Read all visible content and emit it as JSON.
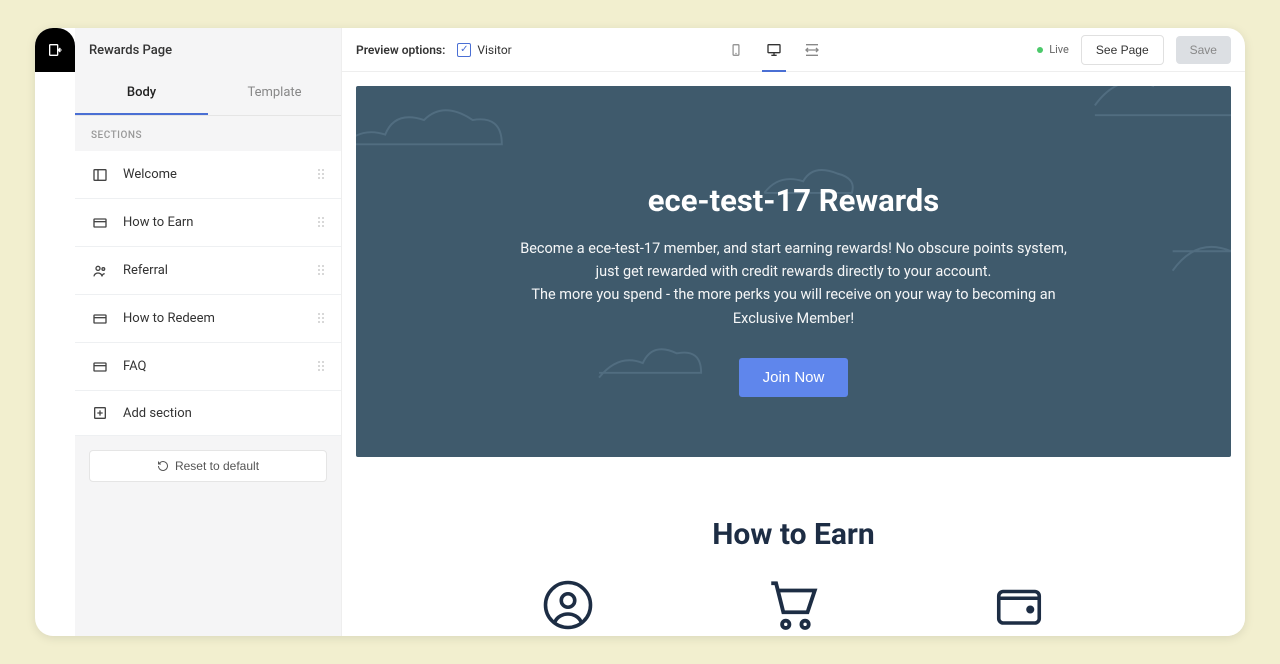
{
  "header": {
    "title": "Rewards Page"
  },
  "sidebar": {
    "tabs": [
      {
        "label": "Body",
        "active": true
      },
      {
        "label": "Template",
        "active": false
      }
    ],
    "sections_header": "SECTIONS",
    "items": [
      {
        "label": "Welcome",
        "icon": "layout-icon"
      },
      {
        "label": "How to Earn",
        "icon": "card-icon"
      },
      {
        "label": "Referral",
        "icon": "people-icon"
      },
      {
        "label": "How to Redeem",
        "icon": "card-icon"
      },
      {
        "label": "FAQ",
        "icon": "card-icon"
      }
    ],
    "add_section_label": "Add section",
    "reset_label": "Reset to default"
  },
  "topbar": {
    "preview_options_label": "Preview options:",
    "visitor_label": "Visitor",
    "status_label": "Live",
    "see_page_label": "See Page",
    "save_label": "Save"
  },
  "preview": {
    "hero_title": "ece-test-17 Rewards",
    "hero_body": "Become a ece-test-17 member, and start earning rewards! No obscure points system, just get rewarded with credit rewards directly to your account.\nThe more you spend - the more perks you will receive on your way to becoming an Exclusive Member!",
    "cta_label": "Join Now",
    "earn_title": "How to Earn"
  }
}
